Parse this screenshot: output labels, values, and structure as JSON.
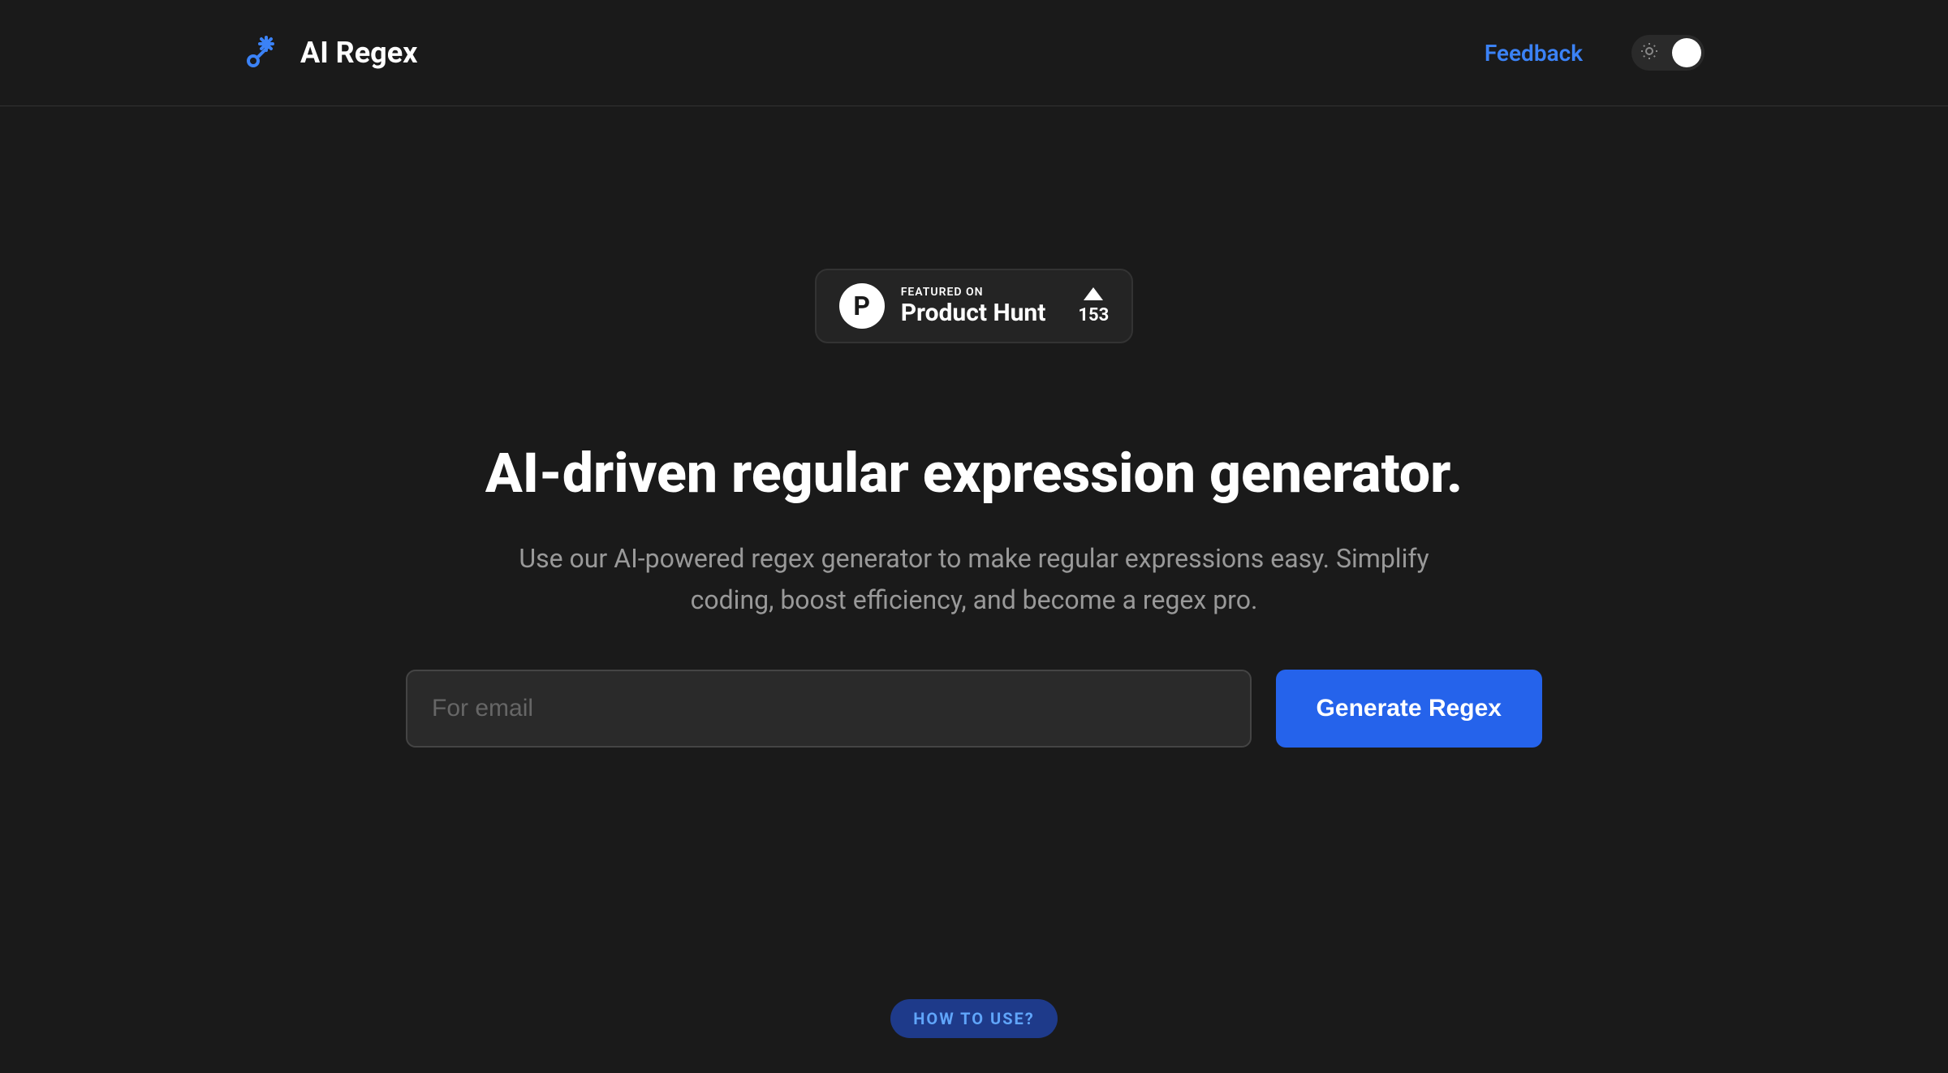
{
  "header": {
    "app_title": "AI Regex",
    "feedback_label": "Feedback"
  },
  "product_hunt": {
    "logo_letter": "P",
    "featured_text": "FEATURED ON",
    "name": "Product Hunt",
    "upvote_count": "153"
  },
  "hero": {
    "title": "AI-driven regular expression generator.",
    "description": "Use our AI-powered regex generator to make regular expressions easy. Simplify coding, boost efficiency, and become a regex pro."
  },
  "input": {
    "placeholder": "For email",
    "button_label": "Generate Regex"
  },
  "how_to": {
    "label": "HOW TO USE?"
  },
  "colors": {
    "accent": "#2563eb",
    "link": "#3b82f6",
    "background": "#1a1a1a"
  }
}
